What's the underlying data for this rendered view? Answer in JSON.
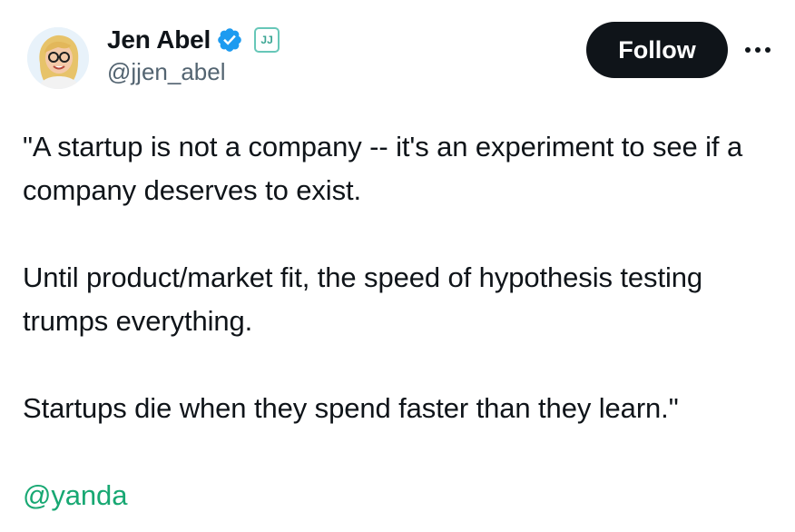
{
  "author": {
    "display_name": "Jen Abel",
    "handle": "@jjen_abel",
    "affiliate_badge_text": "JJ",
    "verified_badge_color": "#1d9bf0",
    "avatar_icon": "avatar-portrait"
  },
  "actions": {
    "follow_label": "Follow",
    "more_icon": "more-dots-icon"
  },
  "tweet": {
    "paragraphs": [
      "\"A startup is not a company -- it's an experiment to see if a company deserves to exist.",
      "Until product/market fit, the speed of hypothesis testing trumps everything.",
      "Startups die when they spend faster than they learn.\""
    ],
    "mention": "@yanda"
  },
  "colors": {
    "text": "#0f1419",
    "secondary_text": "#536471",
    "follow_button_bg": "#0f1419",
    "mention_color": "#18a873",
    "verified_blue": "#1d9bf0"
  }
}
